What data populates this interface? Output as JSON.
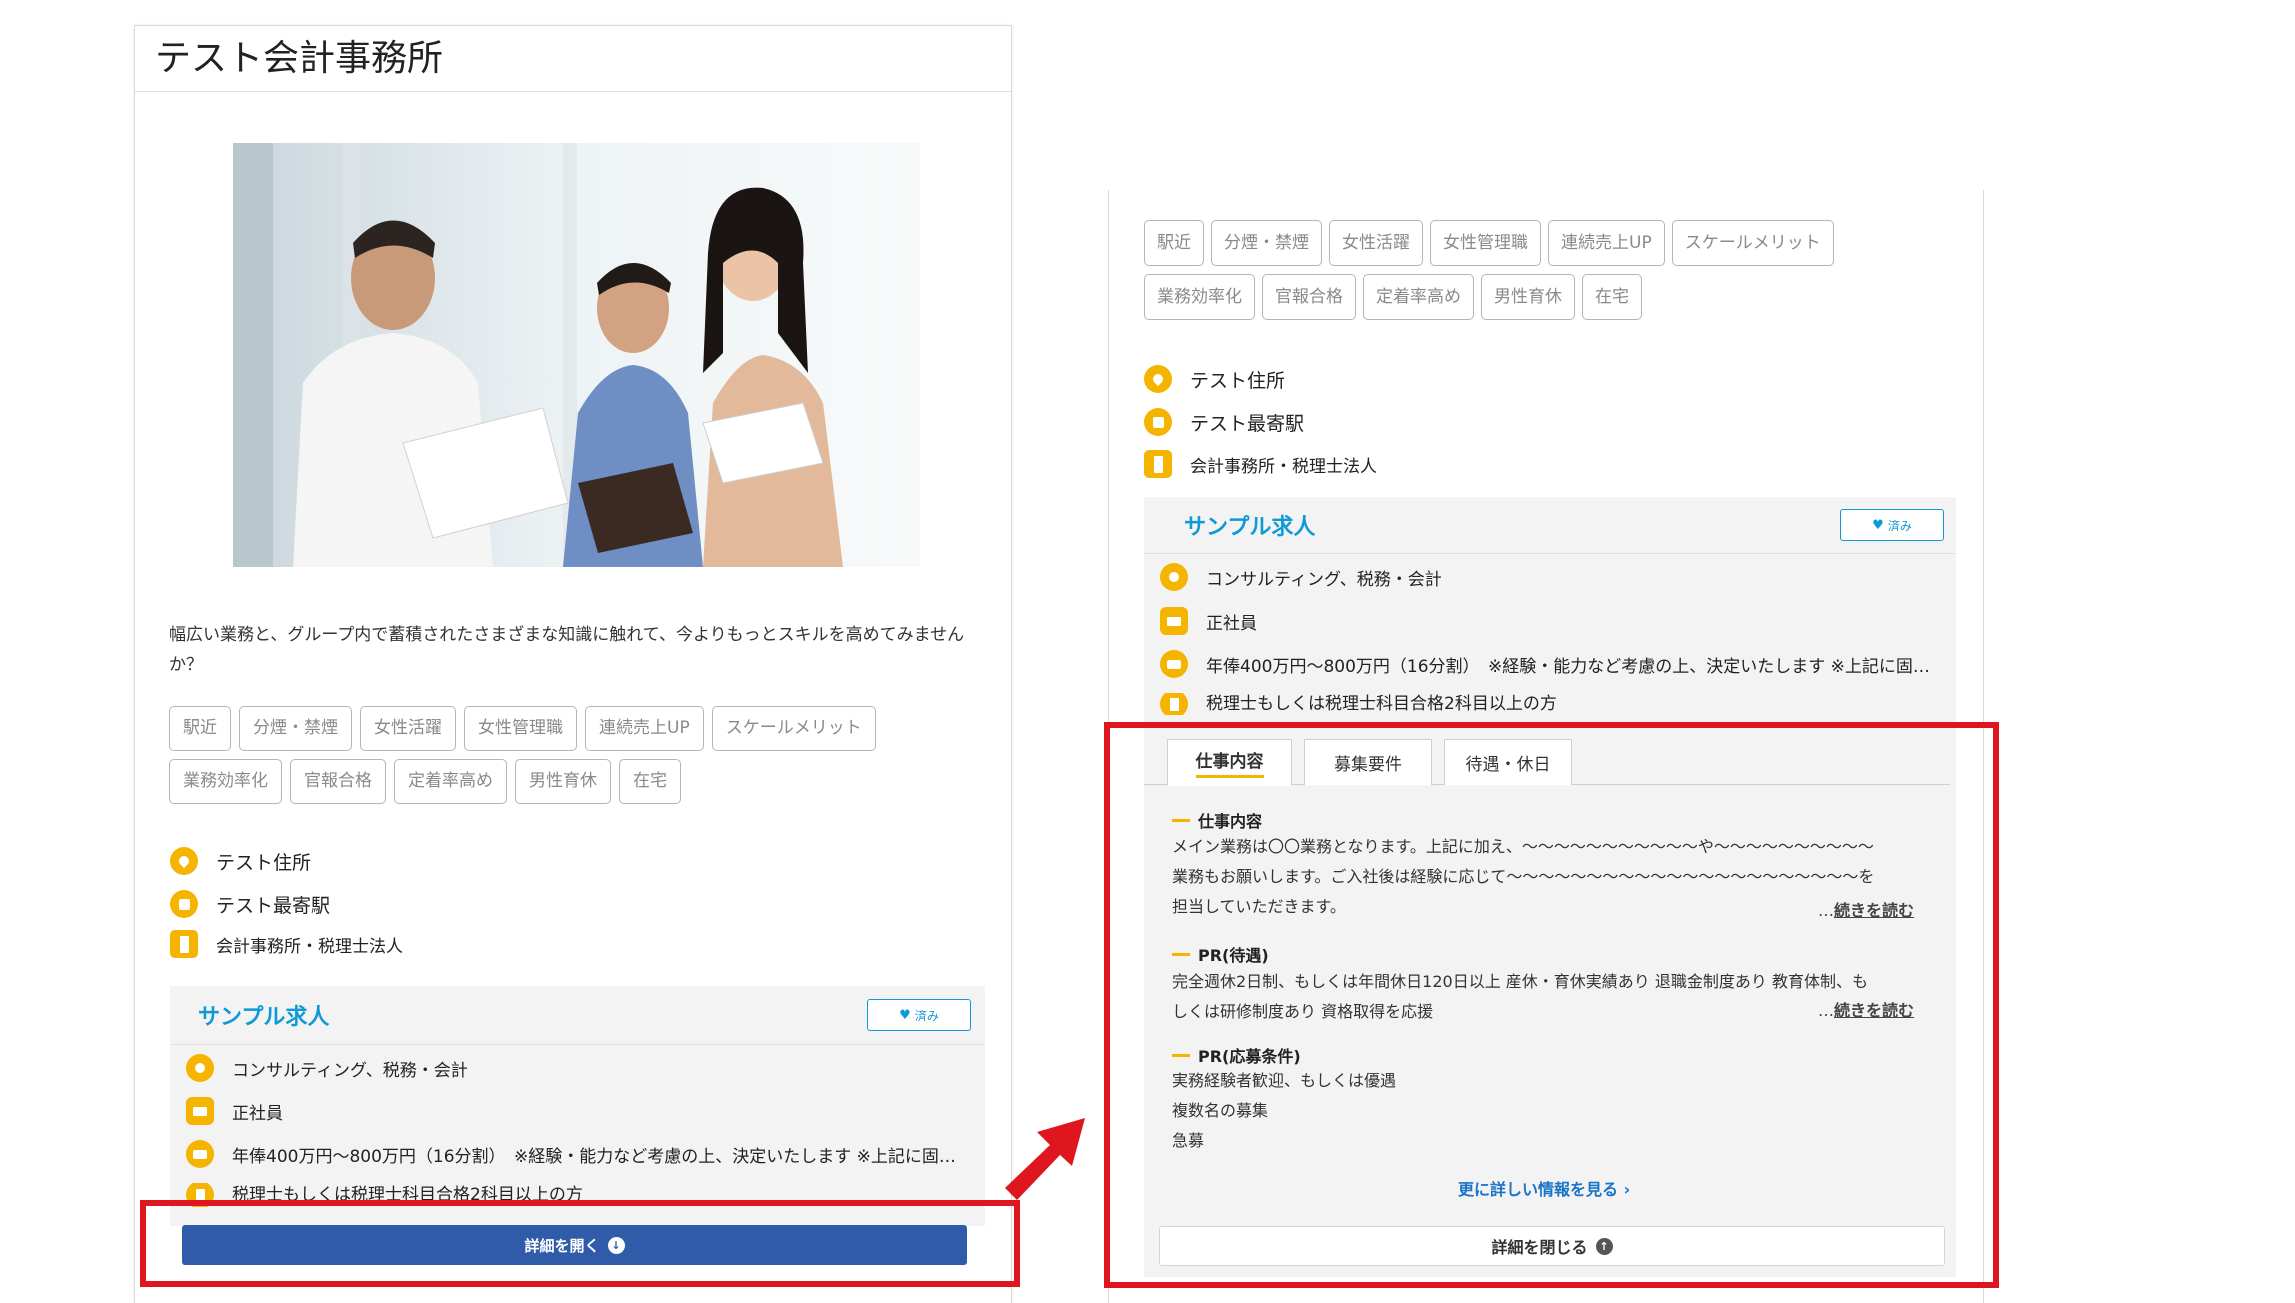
{
  "office": {
    "title": "テスト会計事務所",
    "description": "幅広い業務と、グループ内で蓄積されたさまざまな知識に触れて、今よりもっとスキルを高めてみませんか？",
    "tags": [
      "駅近",
      "分煙・禁煙",
      "女性活躍",
      "女性管理職",
      "連続売上UP",
      "スケールメリット",
      "業務効率化",
      "官報合格",
      "定着率高め",
      "男性育休",
      "在宅"
    ],
    "address": "テスト住所",
    "station": "テスト最寄駅",
    "category": "会計事務所・税理士法人"
  },
  "job": {
    "title": "サンプル求人",
    "fav_label": "済み",
    "field": "コンサルティング、税務・会計",
    "employment": "正社員",
    "salary": "年俸400万円～800万円（16分割）　※経験・能力など考慮の上、決定いたします ※上記に固…",
    "requirement": "税理士もしくは税理士科目合格2科目以上の方",
    "open_button": "詳細を開く",
    "close_button": "詳細を閉じる",
    "more_detail_link": "更に詳しい情報を見る ›"
  },
  "tabs": [
    "仕事内容",
    "募集要件",
    "待遇・休日"
  ],
  "detail": {
    "work_heading": "仕事内容",
    "work_line1": "メイン業務は〇〇業務となります。上記に加え、～～～～～～～～～～～や～～～～～～～～～～",
    "work_line2": "業務もお願いします。ご入社後は経験に応じて～～～～～～～～～～～～～～～～～～～～～～を",
    "work_line3": "担当していただきます。",
    "read_more": "続きを読む",
    "pr_welfare_heading": "PR(待遇)",
    "pr_welfare_line1": "完全週休2日制、もしくは年間休日120日以上 産休・育休実績あり 退職金制度あり 教育体制、も",
    "pr_welfare_line2": "しくは研修制度あり 資格取得を応援",
    "pr_apply_heading": "PR(応募条件)",
    "pr_apply_items": [
      "実務経験者歓迎、もしくは優遇",
      "複数名の募集",
      "急募"
    ]
  },
  "colors": {
    "accent": "#f4b400",
    "brand_blue": "#2f5ba8",
    "title_blue": "#0f9ad6",
    "highlight_red": "#e0161f"
  }
}
